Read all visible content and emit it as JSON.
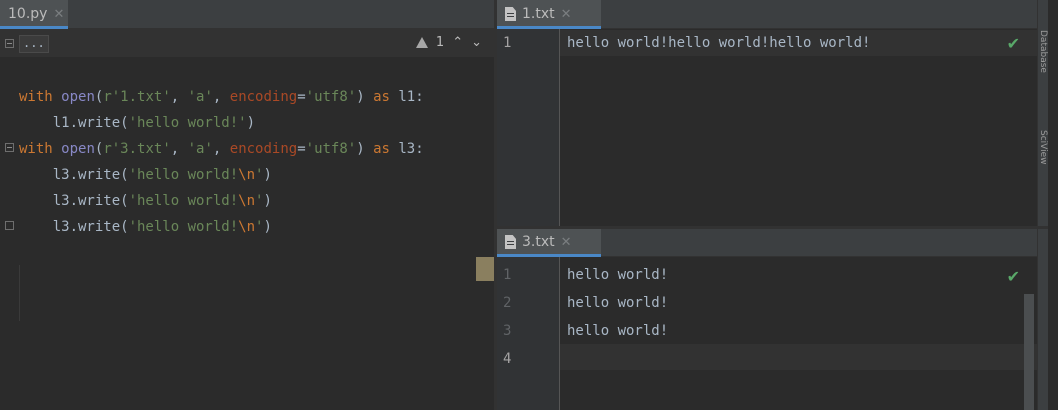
{
  "left_editor": {
    "tab": {
      "name": "10.py"
    },
    "collapsed_label": "...",
    "inspection": {
      "count": "1"
    },
    "lines": [
      [
        {
          "t": "with",
          "c": "kw"
        },
        {
          "t": " "
        },
        {
          "t": "open",
          "c": "fn"
        },
        {
          "t": "("
        },
        {
          "t": "r'1.txt'",
          "c": "str"
        },
        {
          "t": ", "
        },
        {
          "t": "'a'",
          "c": "str"
        },
        {
          "t": ", "
        },
        {
          "t": "encoding",
          "c": "param"
        },
        {
          "t": "="
        },
        {
          "t": "'utf8'",
          "c": "str"
        },
        {
          "t": ") "
        },
        {
          "t": "as",
          "c": "kw"
        },
        {
          "t": " l1:"
        }
      ],
      [
        {
          "t": "    l1.write("
        },
        {
          "t": "'hello world!'",
          "c": "str"
        },
        {
          "t": ")"
        }
      ],
      [
        {
          "t": "with",
          "c": "kw"
        },
        {
          "t": " "
        },
        {
          "t": "open",
          "c": "fn"
        },
        {
          "t": "("
        },
        {
          "t": "r'3.txt'",
          "c": "str"
        },
        {
          "t": ", "
        },
        {
          "t": "'a'",
          "c": "str"
        },
        {
          "t": ", "
        },
        {
          "t": "encoding",
          "c": "param"
        },
        {
          "t": "="
        },
        {
          "t": "'utf8'",
          "c": "str"
        },
        {
          "t": ") "
        },
        {
          "t": "as",
          "c": "kw"
        },
        {
          "t": " l3:"
        }
      ],
      [
        {
          "t": "    l3.write("
        },
        {
          "t": "'hello world!",
          "c": "str"
        },
        {
          "t": "\\n",
          "c": "esc"
        },
        {
          "t": "'",
          "c": "str"
        },
        {
          "t": ")"
        }
      ],
      [
        {
          "t": "    l3.write("
        },
        {
          "t": "'hello world!",
          "c": "str"
        },
        {
          "t": "\\n",
          "c": "esc"
        },
        {
          "t": "'",
          "c": "str"
        },
        {
          "t": ")"
        }
      ],
      [
        {
          "t": "    l3.write("
        },
        {
          "t": "'hello world!",
          "c": "str"
        },
        {
          "t": "\\n",
          "c": "esc"
        },
        {
          "t": "'",
          "c": "str"
        },
        {
          "t": ")"
        }
      ]
    ]
  },
  "top_editor": {
    "tab": {
      "name": "1.txt"
    },
    "lines": [
      {
        "num": "1",
        "text": "hello world!hello world!hello world!"
      }
    ]
  },
  "bottom_editor": {
    "tab": {
      "name": "3.txt"
    },
    "lines": [
      {
        "num": "1",
        "text": "hello world!"
      },
      {
        "num": "2",
        "text": "hello world!"
      },
      {
        "num": "3",
        "text": "hello world!"
      },
      {
        "num": "4",
        "text": ""
      }
    ]
  },
  "side_strip": {
    "labels": [
      "Database",
      "SciView"
    ]
  },
  "icons": {
    "tab_close": "close-icon",
    "file": "text-file-icon",
    "status_ok": "checkmark-icon",
    "warning": "warning-icon"
  },
  "colors": {
    "keyword": "#cc7832",
    "builtin": "#8888c6",
    "string": "#6a8759",
    "param": "#aa4926",
    "tab_accent": "#4a88c7",
    "ok": "#59a869"
  }
}
